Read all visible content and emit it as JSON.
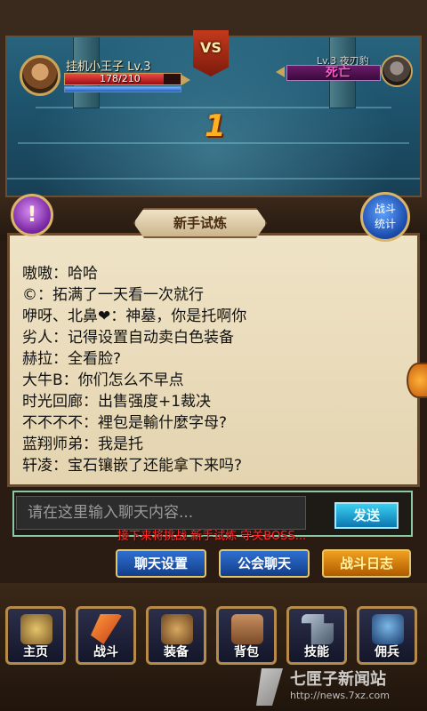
{
  "battle": {
    "vs_label": "VS",
    "damage_number": "1",
    "player": {
      "name": "挂机小王子 Lv.3",
      "hp_text": "178/210",
      "hp_fraction": 0.85
    },
    "enemy": {
      "name": "Lv.3 夜刃豹",
      "status": "死亡"
    }
  },
  "panel_title": "新手试炼",
  "quest_icon_label": "!",
  "stats_button": {
    "line1": "战斗",
    "line2": "统计"
  },
  "chat_messages": [
    "嗷嗷：哈哈",
    "©：拓满了一天看一次就行",
    "咿呀、北鼻❤：神墓，你是托啊你",
    "劣人：记得设置自动卖白色装备",
    "赫拉：全看脸?",
    "大牛B：你们怎么不早点",
    "时光回廊：出售强度+1裁决",
    "不不不不：裡包是輸什麼字母?",
    "蓝翔师弟：我是托",
    "轩凌：宝石镶嵌了还能拿下来吗?"
  ],
  "chat_input": {
    "placeholder": "请在这里输入聊天内容...",
    "value": ""
  },
  "send_button": "发送",
  "boss_notice": "接下来将挑战 新手试炼 守关BOSS...",
  "action_buttons": [
    "聊天设置",
    "公会聊天",
    "战斗日志"
  ],
  "nav": [
    {
      "label": "主页",
      "icon": "shield-icon"
    },
    {
      "label": "战斗",
      "icon": "axe-icon"
    },
    {
      "label": "装备",
      "icon": "armor-icon"
    },
    {
      "label": "背包",
      "icon": "backpack-icon"
    },
    {
      "label": "技能",
      "icon": "hammer-icon"
    },
    {
      "label": "佣兵",
      "icon": "helmet-icon"
    }
  ],
  "watermark": {
    "title": "七匣子新闻站",
    "url": "http://news.7xz.com"
  },
  "colors": {
    "hp_red": "#f04848",
    "boss_notice": "#ff2a2a",
    "accent_gold": "#d9b56b",
    "dead_magenta": "#ff5ad0"
  }
}
